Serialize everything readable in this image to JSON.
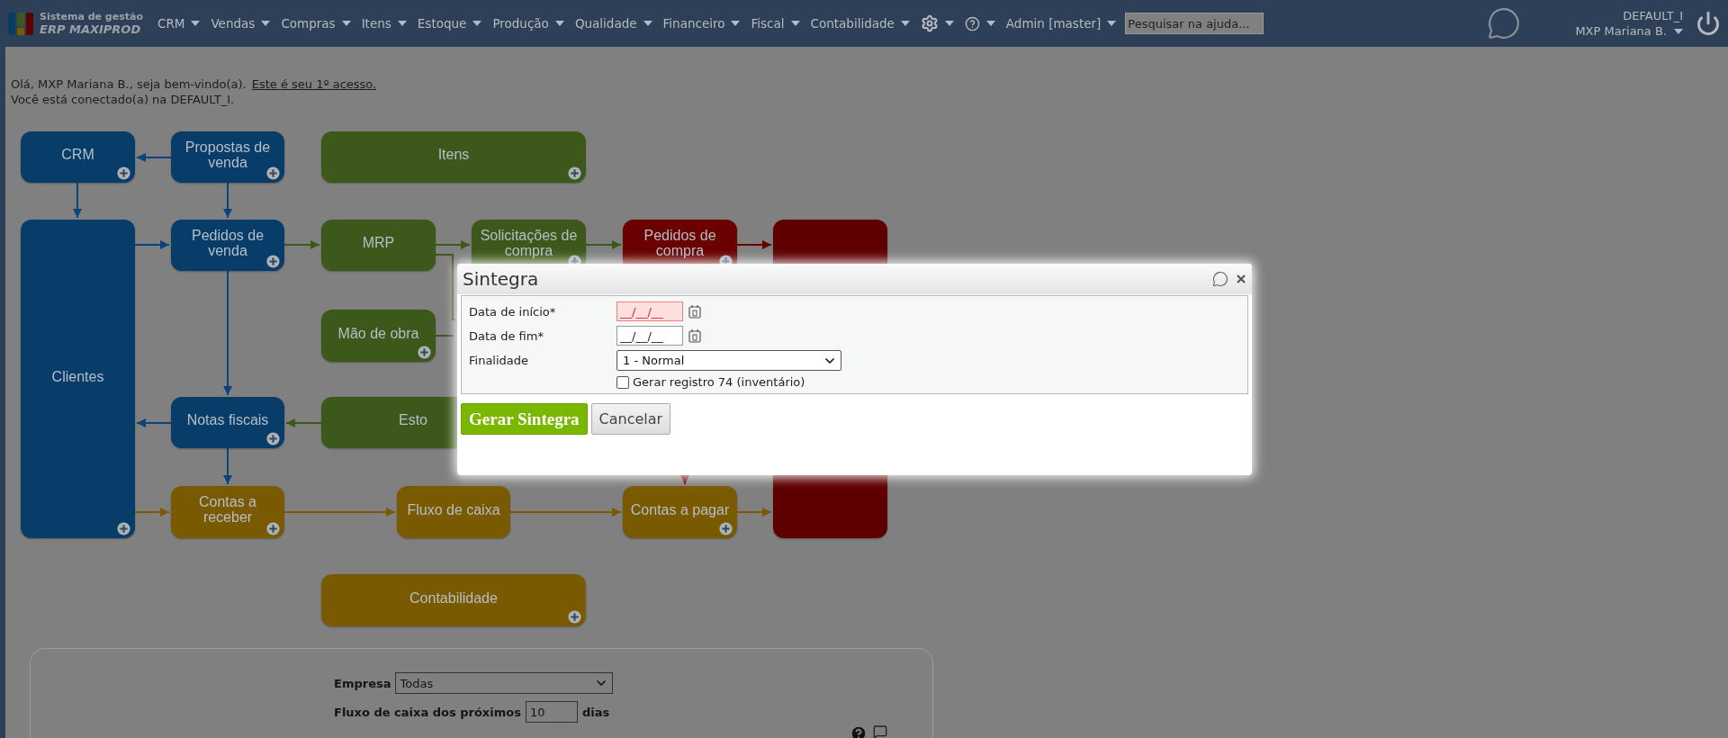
{
  "header": {
    "brand": {
      "line1": "Sistema de gestão",
      "line2": "ERP MAXIPROD"
    },
    "menu": [
      {
        "kind": "text",
        "label": "CRM"
      },
      {
        "kind": "text",
        "label": "Vendas"
      },
      {
        "kind": "text",
        "label": "Compras"
      },
      {
        "kind": "text",
        "label": "Itens"
      },
      {
        "kind": "text",
        "label": "Estoque"
      },
      {
        "kind": "text",
        "label": "Produção"
      },
      {
        "kind": "text",
        "label": "Qualidade"
      },
      {
        "kind": "text",
        "label": "Financeiro"
      },
      {
        "kind": "text",
        "label": "Fiscal"
      },
      {
        "kind": "text",
        "label": "Contabilidade"
      },
      {
        "kind": "gear"
      },
      {
        "kind": "help"
      },
      {
        "kind": "text",
        "label": "Admin [master]"
      }
    ],
    "search": {
      "placeholder": "Pesquisar na ajuda..."
    },
    "company": "DEFAULT_I",
    "user": "MXP Mariana B."
  },
  "welcome": {
    "greeting": "Olá, MXP Mariana B., seja bem-vindo(a).",
    "link": "Este é seu 1º acesso.",
    "connection": "Você está conectado(a) na DEFAULT_I."
  },
  "flow": {
    "nodes": [
      {
        "label": "CRM",
        "color": "#083c69",
        "add": true
      },
      {
        "label": "Propostas de venda",
        "color": "#083c69",
        "add": true
      },
      {
        "label": "Itens",
        "color": "#3d581b",
        "add": true
      },
      {
        "label": "Clientes",
        "color": "#083c69",
        "add": true
      },
      {
        "label": "Pedidos de venda",
        "color": "#083c69",
        "add": true
      },
      {
        "label": "MRP",
        "color": "#3d581b",
        "add": false
      },
      {
        "label": "Solicitações de compra",
        "color": "#3d581b",
        "add": true
      },
      {
        "label": "Pedidos de compra",
        "color": "#6a0000",
        "add": true
      },
      {
        "color": "#5e0000",
        "add": false
      },
      {
        "label": "Mão de obra",
        "color": "#3d581b",
        "add": true
      },
      {
        "label": "Notas fiscais",
        "color": "#083c69",
        "add": true
      },
      {
        "label": "Esto",
        "color": "#3d581b"
      },
      {
        "label": "Contas a receber",
        "color": "#7a5a00",
        "add": true
      },
      {
        "label": "Fluxo de caixa",
        "color": "#7a5a00",
        "add": false
      },
      {
        "label": "Contas a pagar",
        "color": "#7a5a00",
        "add": true
      },
      {
        "label": "Contabilidade",
        "color": "#7a5a00",
        "add": true
      }
    ]
  },
  "dialog": {
    "title": "Sintegra",
    "fields": [
      {
        "kind": "date",
        "label": "Data de início*",
        "placeholder": "__/__/__",
        "invalid": true
      },
      {
        "kind": "date",
        "label": "Data de fim*",
        "placeholder": "__/__/__",
        "invalid": false
      },
      {
        "kind": "select",
        "label": "Finalidade",
        "value": "1 - Normal"
      },
      {
        "kind": "checkbox",
        "label": "Gerar registro 74 (inventário)",
        "checked": false
      }
    ],
    "buttons": [
      {
        "label": "Gerar Sintegra",
        "primary": true
      },
      {
        "label": "Cancelar",
        "primary": false
      }
    ]
  },
  "panel": {
    "company_label": "Empresa",
    "company_value": "Todas",
    "cashflow_label": "Fluxo de caixa dos próximos",
    "cashflow_days": "10",
    "cashflow_unit": "dias"
  }
}
